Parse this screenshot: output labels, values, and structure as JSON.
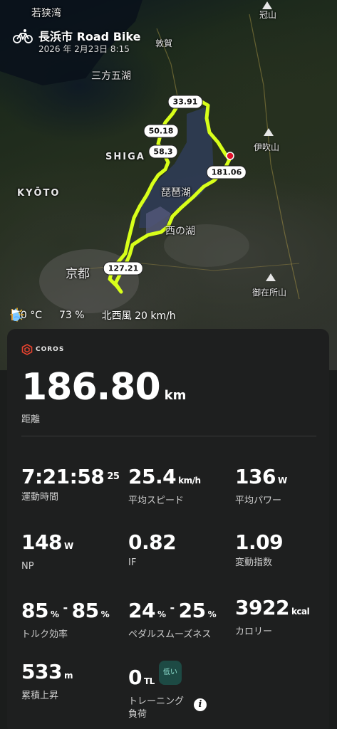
{
  "header": {
    "title": "長浜市 Road Bike",
    "date": "2026 年 2月23日 8:15",
    "activity_icon": "road-bike-icon"
  },
  "map": {
    "labels": {
      "wakasa_bay": "若狭湾",
      "kanmuri": "冠山",
      "tsuruga": "敦賀",
      "mikata_goko": "三方五湖",
      "shiga": "SHIGA",
      "ibukiyama": "伊吹山",
      "kyoto_en": "KYŌTO",
      "biwako": "琵琶湖",
      "nishinoko": "西の湖",
      "kyoto": "京都",
      "gozaishoyama": "御在所山"
    },
    "route_color": "#d8ff1a",
    "markers": [
      "33.91",
      "50.18",
      "58.3",
      "181.06",
      "127.21"
    ]
  },
  "weather": {
    "temperature": "10 °C",
    "humidity": "73 %",
    "wind": "北西風 20 km/h"
  },
  "brand": {
    "name": "COROS",
    "icon": "coros-logo-icon"
  },
  "summary": {
    "distance": {
      "value": "186.80",
      "unit": "km",
      "label": "距離"
    }
  },
  "stats": {
    "moving_time": {
      "value": "7:21:58",
      "sub": "25",
      "label": "運動時間"
    },
    "avg_speed": {
      "value": "25.4",
      "unit": "km/h",
      "label": "平均スピード"
    },
    "avg_power": {
      "value": "136",
      "unit": "W",
      "label": "平均パワー"
    },
    "np": {
      "value": "148",
      "unit": "W",
      "label": "NP"
    },
    "if": {
      "value": "0.82",
      "label": "IF"
    },
    "vi": {
      "value": "1.09",
      "label": "変動指数"
    },
    "torque_eff": {
      "left": "85",
      "right": "85",
      "unit": "%",
      "dash": "-",
      "label": "トルク効率"
    },
    "pedal_smooth": {
      "left": "24",
      "right": "25",
      "unit": "%",
      "dash": "-",
      "label": "ペダルスムーズネス"
    },
    "calories": {
      "value": "3922",
      "unit": "kcal",
      "label": "カロリー"
    },
    "elevation": {
      "value": "533",
      "unit": "m",
      "label": "累積上昇"
    },
    "training_load": {
      "value": "0",
      "unit": "TL",
      "badge": "低い",
      "label_line1": "トレーニング",
      "label_line2": "負荷"
    }
  },
  "colors": {
    "accent_route": "#d8ff1a",
    "start_dot": "#e0102a",
    "badge_bg": "#1d4a44",
    "card_bg": "#1e1f1f"
  }
}
